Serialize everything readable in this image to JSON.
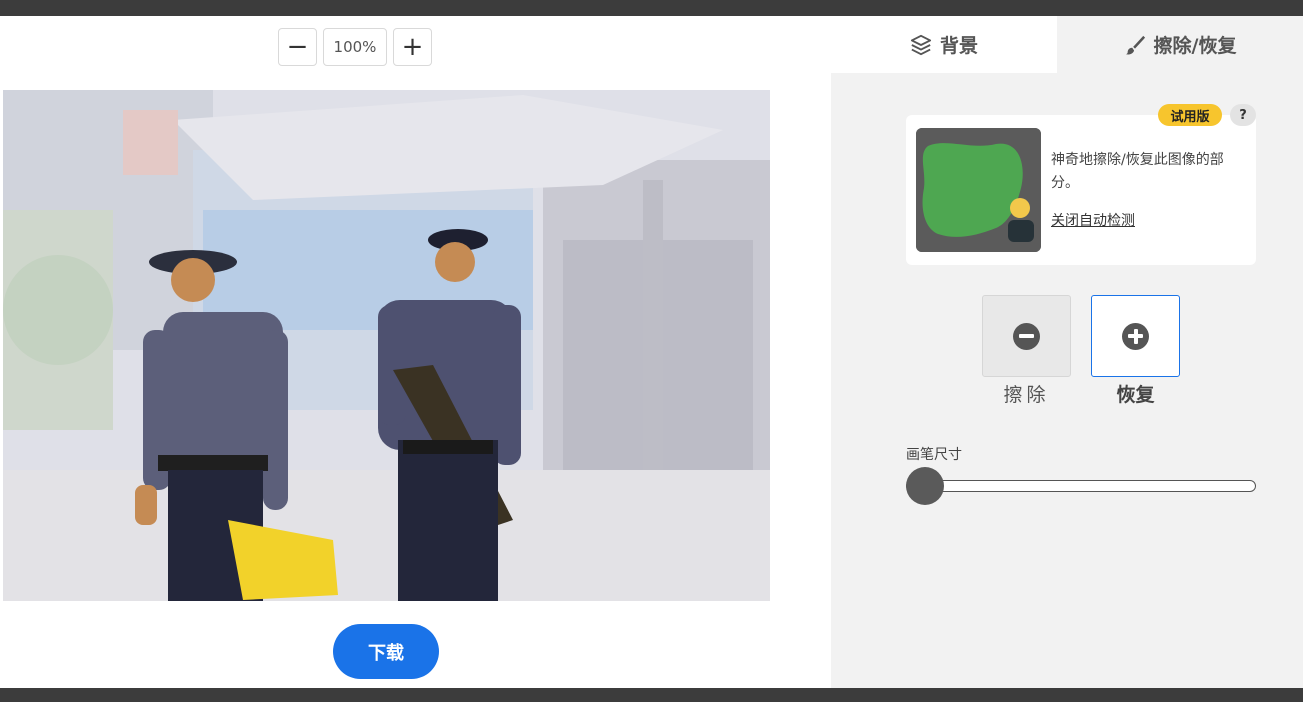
{
  "zoom": {
    "minus_label": "−",
    "value": "100%",
    "plus_label": "+"
  },
  "download_label": "下载",
  "tabs": [
    {
      "label": "背景",
      "icon": "layers-icon"
    },
    {
      "label": "擦除/恢复",
      "icon": "brush-icon",
      "active": true
    }
  ],
  "promo": {
    "badge": "试用版",
    "help": "?",
    "text": "神奇地擦除/恢复此图像的部分。",
    "link": "关闭自动检测"
  },
  "modes": [
    {
      "label": "擦除",
      "icon": "minus-circle-icon",
      "selected": false
    },
    {
      "label": "恢复",
      "icon": "plus-circle-icon",
      "selected": true
    }
  ],
  "brush": {
    "label": "画笔尺寸",
    "value": 0.0
  },
  "colors": {
    "accent": "#1a73e8",
    "badge": "#f7c52d",
    "panel": "#f2f2f2",
    "thumb_green": "#4caf50"
  }
}
